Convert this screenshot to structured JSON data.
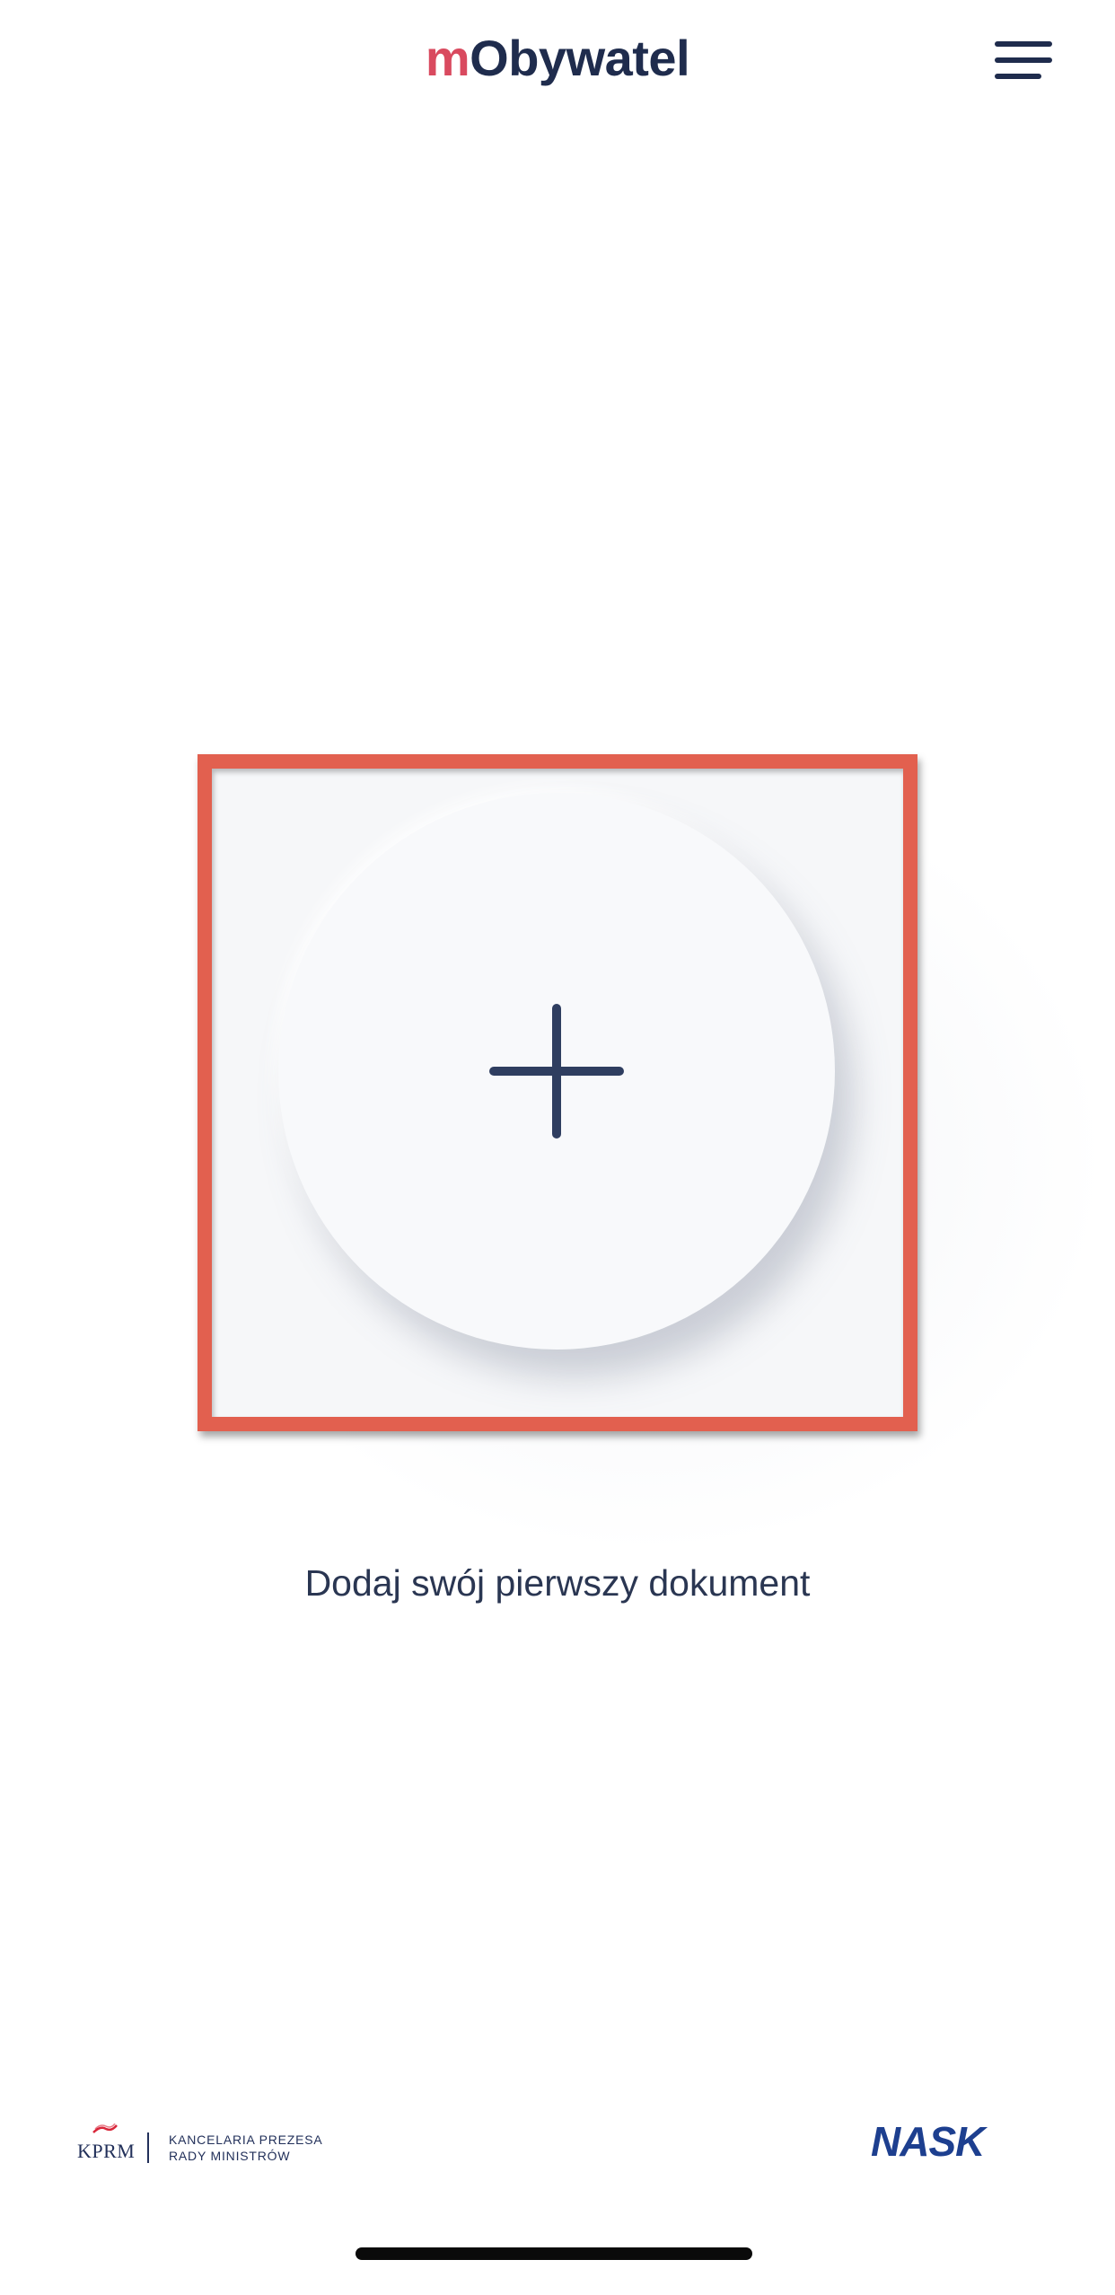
{
  "header": {
    "title_prefix": "m",
    "title_main": "Obywatel",
    "menu_icon": "hamburger-menu-icon"
  },
  "main": {
    "add_icon": "plus-icon",
    "add_label": "Dodaj swój pierwszy dokument",
    "highlight_color": "#e2604f"
  },
  "footer": {
    "kprm_abbr": "KPRM",
    "kprm_line1": "KANCELARIA PREZESA",
    "kprm_line2": "RADY MINISTRÓW",
    "nask": "NASK"
  },
  "colors": {
    "brand_accent": "#d94a5f",
    "brand_dark": "#1f2c4d",
    "nask_blue": "#1d3f8f"
  }
}
